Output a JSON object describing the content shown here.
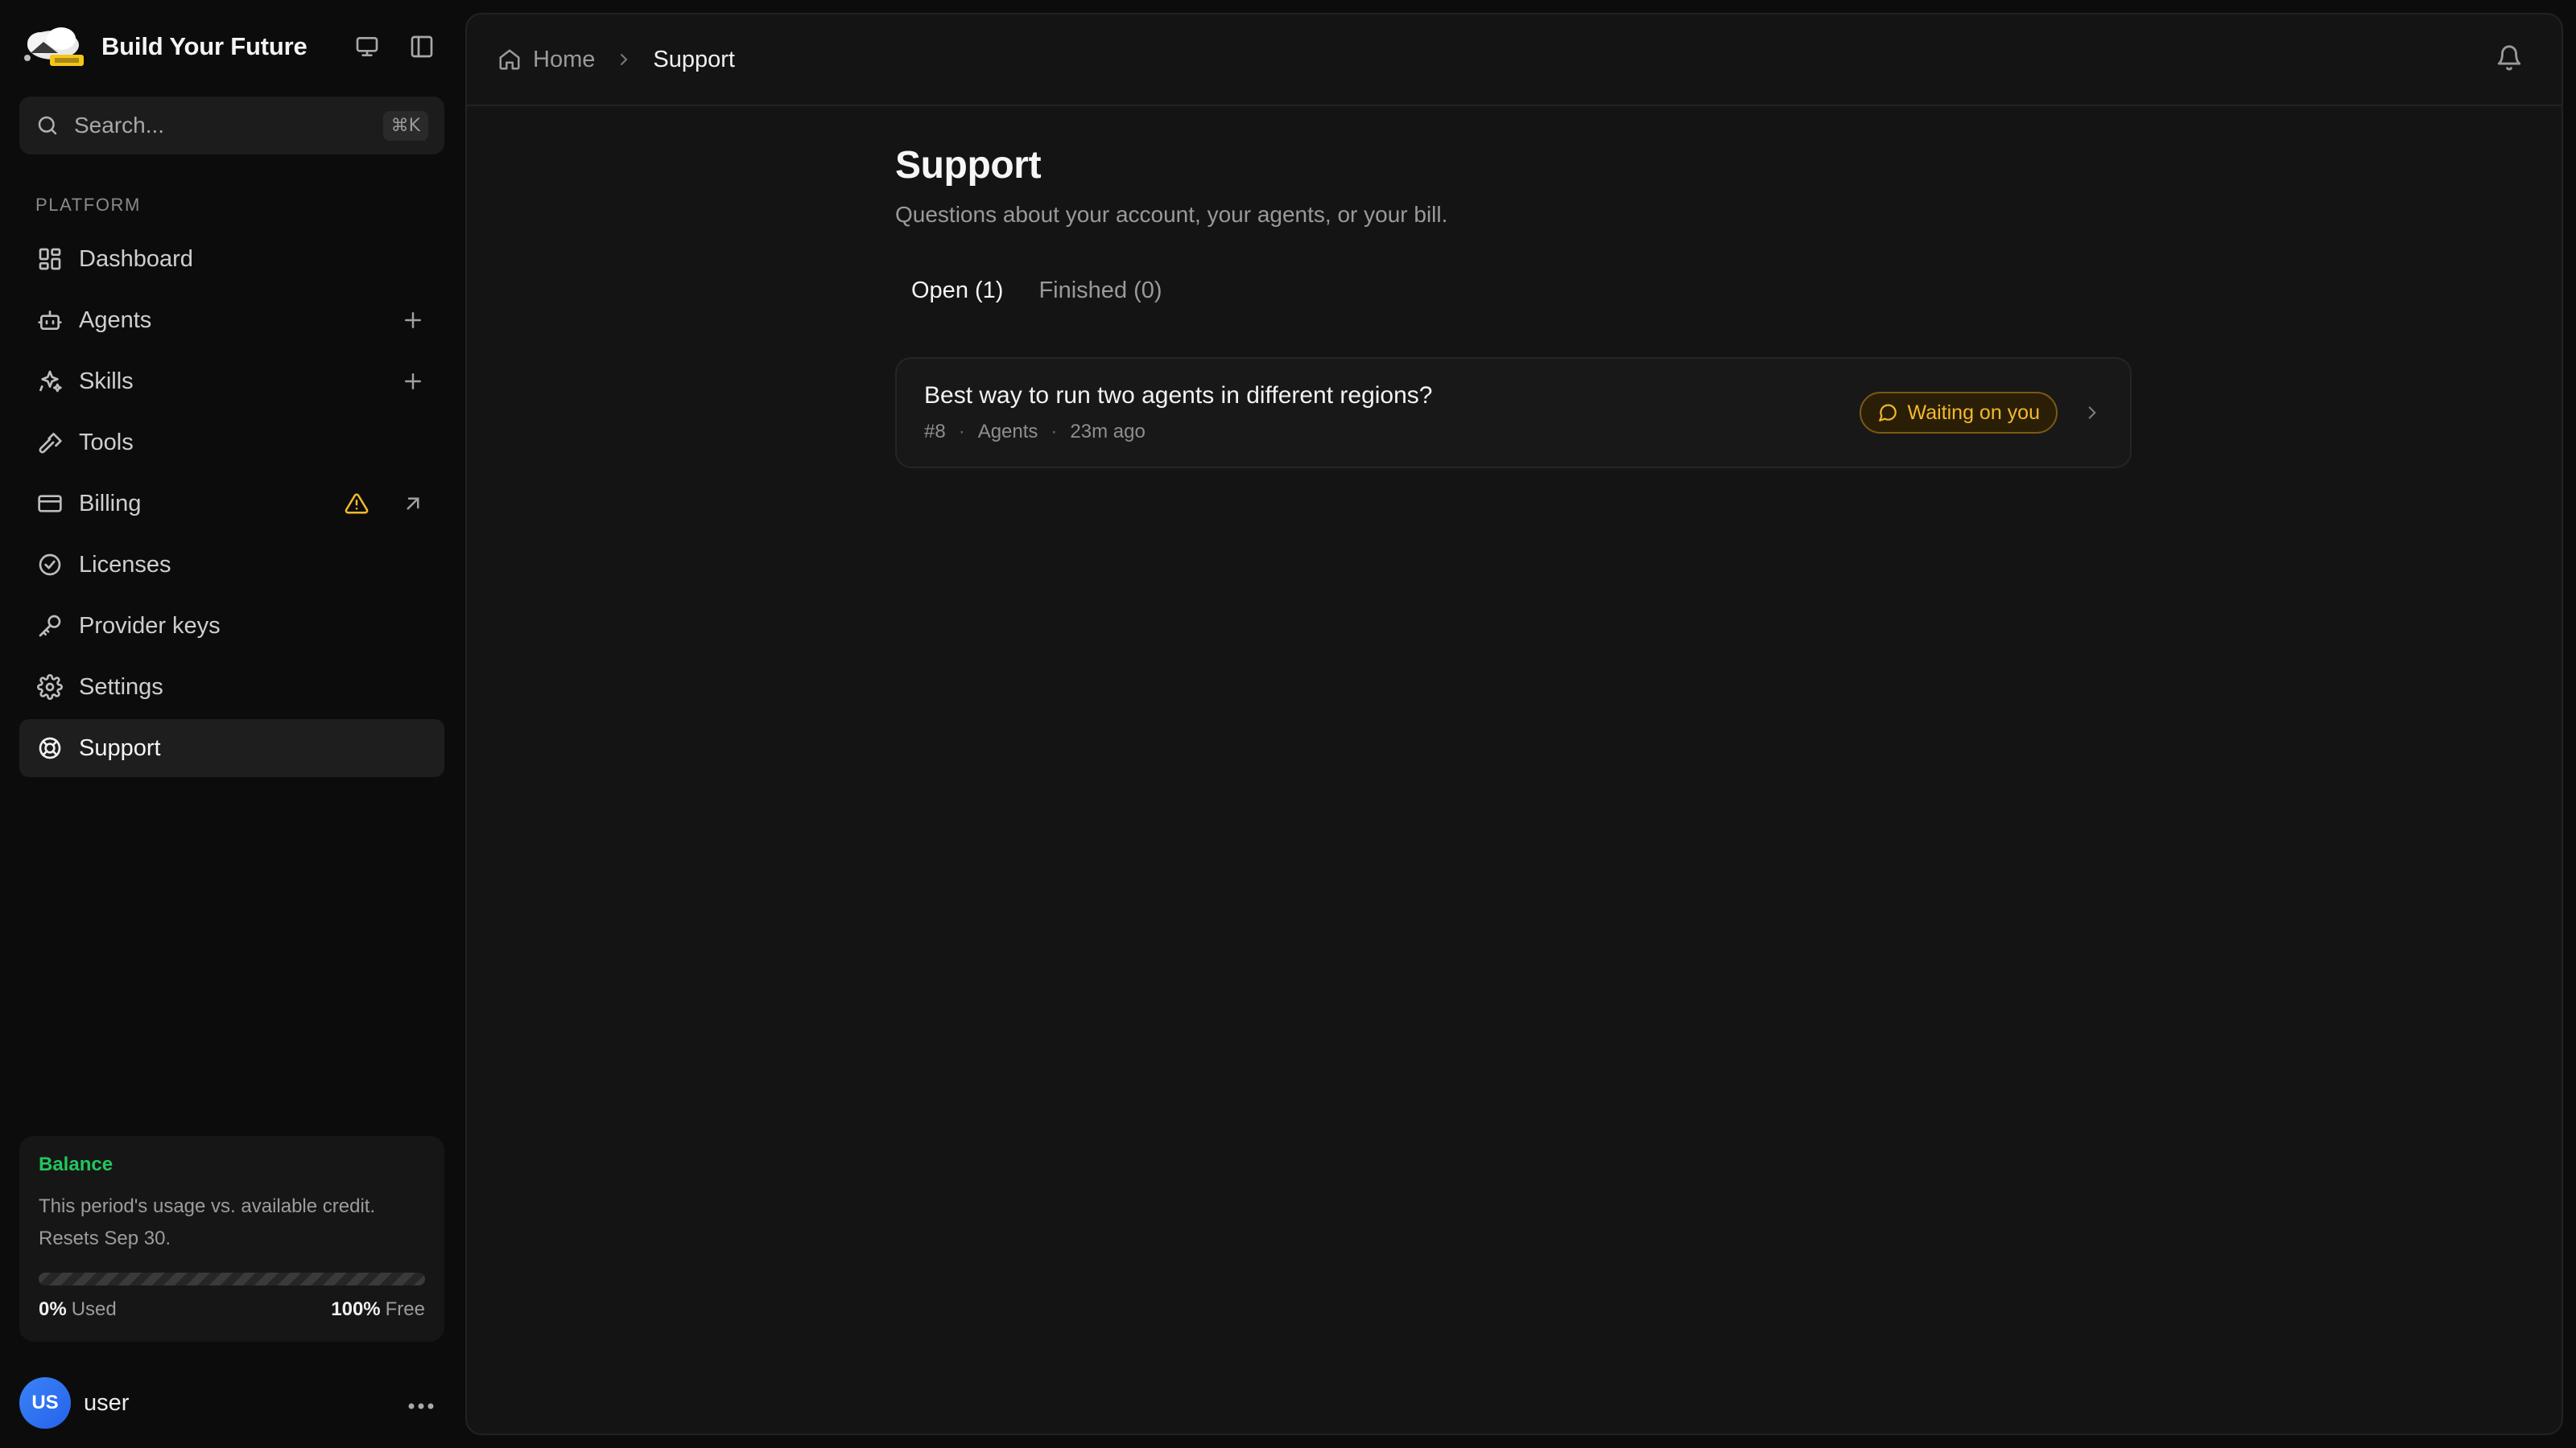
{
  "brand": {
    "name": "Build Your Future"
  },
  "search": {
    "placeholder": "Search...",
    "shortcut": "⌘K"
  },
  "sidebar": {
    "section_label": "PLATFORM",
    "items": [
      {
        "label": "Dashboard",
        "icon": "dashboard-icon"
      },
      {
        "label": "Agents",
        "icon": "robot-icon"
      },
      {
        "label": "Skills",
        "icon": "sparkles-icon"
      },
      {
        "label": "Tools",
        "icon": "hammer-icon"
      },
      {
        "label": "Billing",
        "icon": "credit-card-icon"
      },
      {
        "label": "Licenses",
        "icon": "badge-check-icon"
      },
      {
        "label": "Provider keys",
        "icon": "key-icon"
      },
      {
        "label": "Settings",
        "icon": "gear-icon"
      },
      {
        "label": "Support",
        "icon": "lifebuoy-icon"
      }
    ],
    "active": "Support"
  },
  "balance": {
    "title": "Balance",
    "description_line1": "This period's usage vs. available credit.",
    "description_line2": "Resets Sep 30.",
    "used_percent": "0%",
    "used_label": "Used",
    "free_percent": "100%",
    "free_label": "Free",
    "used_fraction": 0
  },
  "user": {
    "initials": "US",
    "name": "user"
  },
  "breadcrumb": {
    "home": "Home",
    "current": "Support"
  },
  "page": {
    "title": "Support",
    "subtitle": "Questions about your account, your agents, or your bill."
  },
  "tabs": [
    {
      "label": "Open (1)",
      "active": true
    },
    {
      "label": "Finished (0)",
      "active": false
    }
  ],
  "tickets": [
    {
      "title": "Best way to run two agents in different regions?",
      "id": "#8",
      "category": "Agents",
      "time": "23m ago",
      "status": "Waiting on you"
    }
  ],
  "colors": {
    "accent_green": "#22c55e",
    "status_amber": "#f5b82e",
    "avatar_blue": "#3b82f6"
  }
}
